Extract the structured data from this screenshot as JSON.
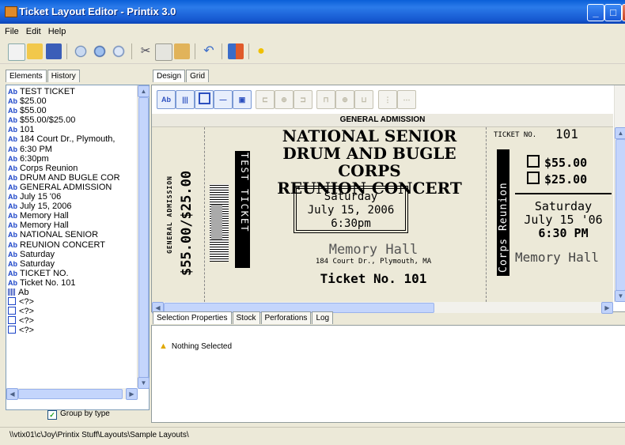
{
  "window": {
    "title": "Ticket Layout Editor - Printix 3.0",
    "min": "_",
    "max": "□",
    "close": "X"
  },
  "menu": [
    "File",
    "Edit",
    "Help"
  ],
  "left_tabs": [
    "Elements",
    "History"
  ],
  "elements": [
    {
      "kind": "text",
      "icon": "Ab",
      "label": "TEST TICKET"
    },
    {
      "kind": "text",
      "icon": "Ab",
      "label": "$25.00"
    },
    {
      "kind": "text",
      "icon": "Ab",
      "label": "$55.00"
    },
    {
      "kind": "text",
      "icon": "Ab",
      "label": "$55.00/$25.00"
    },
    {
      "kind": "text",
      "icon": "Ab",
      "label": "101"
    },
    {
      "kind": "text",
      "icon": "Ab",
      "label": "184 Court Dr., Plymouth,"
    },
    {
      "kind": "text",
      "icon": "Ab",
      "label": "6:30 PM"
    },
    {
      "kind": "text",
      "icon": "Ab",
      "label": "6:30pm"
    },
    {
      "kind": "text",
      "icon": "Ab",
      "label": "Corps Reunion"
    },
    {
      "kind": "text",
      "icon": "Ab",
      "label": "DRUM AND BUGLE COR"
    },
    {
      "kind": "text",
      "icon": "Ab",
      "label": "GENERAL ADMISSION"
    },
    {
      "kind": "text",
      "icon": "Ab",
      "label": "July 15 '06"
    },
    {
      "kind": "text",
      "icon": "Ab",
      "label": "July 15, 2006"
    },
    {
      "kind": "text",
      "icon": "Ab",
      "label": "Memory Hall"
    },
    {
      "kind": "text",
      "icon": "Ab",
      "label": "Memory Hall"
    },
    {
      "kind": "text",
      "icon": "Ab",
      "label": "NATIONAL SENIOR"
    },
    {
      "kind": "text",
      "icon": "Ab",
      "label": "REUNION CONCERT"
    },
    {
      "kind": "text",
      "icon": "Ab",
      "label": "Saturday"
    },
    {
      "kind": "text",
      "icon": "Ab",
      "label": "Saturday"
    },
    {
      "kind": "text",
      "icon": "Ab",
      "label": "TICKET NO."
    },
    {
      "kind": "text",
      "icon": "Ab",
      "label": "Ticket No. 101"
    },
    {
      "kind": "barcode",
      "icon": "",
      "label": "Ab"
    },
    {
      "kind": "box",
      "icon": "",
      "label": "<?>"
    },
    {
      "kind": "box",
      "icon": "",
      "label": "<?>"
    },
    {
      "kind": "box",
      "icon": "",
      "label": "<?>"
    },
    {
      "kind": "box",
      "icon": "",
      "label": "<?>"
    }
  ],
  "group_by_type": {
    "label": "Group by type",
    "checked": true
  },
  "design_tabs": [
    "Design",
    "Grid"
  ],
  "design_tools": [
    {
      "name": "text-tool-icon",
      "glyph": "Ab",
      "enabled": true
    },
    {
      "name": "barcode-tool-icon",
      "glyph": "|||",
      "enabled": true
    },
    {
      "name": "rectangle-tool-icon",
      "glyph": "",
      "enabled": true
    },
    {
      "name": "line-tool-icon",
      "glyph": "—",
      "enabled": true
    },
    {
      "name": "image-tool-icon",
      "glyph": "▣",
      "enabled": true
    },
    {
      "name": "align-left-icon",
      "glyph": "⊏",
      "enabled": false
    },
    {
      "name": "align-center-icon",
      "glyph": "⊕",
      "enabled": false
    },
    {
      "name": "align-right-icon",
      "glyph": "⊐",
      "enabled": false
    },
    {
      "name": "align-top-icon",
      "glyph": "⊓",
      "enabled": false
    },
    {
      "name": "align-middle-icon",
      "glyph": "⊕",
      "enabled": false
    },
    {
      "name": "align-bottom-icon",
      "glyph": "⊔",
      "enabled": false
    },
    {
      "name": "space-horizontal-icon",
      "glyph": "⋮",
      "enabled": false
    },
    {
      "name": "space-vertical-icon",
      "glyph": "⋯",
      "enabled": false
    }
  ],
  "ticket": {
    "header": "GENERAL ADMISSION",
    "line1": "NATIONAL SENIOR",
    "line2": "DRUM AND BUGLE CORPS",
    "line3": "REUNION CONCERT",
    "day": "Saturday",
    "date": "July 15, 2006",
    "time": "6:30pm",
    "venue": "Memory Hall",
    "address": "184 Court Dr., Plymouth, MA",
    "ticket_no": "Ticket No. 101",
    "side_price": "$55.00/$25.00",
    "side_label": "GENERAL ADMISSION",
    "test_ticket": "TEST TICKET",
    "stub_ticket_label": "TICKET NO.",
    "stub_ticket_num": "101",
    "stub_corps": "Corps Reunion",
    "stub_price1": "$55.00",
    "stub_price2": "$25.00",
    "stub_day": "Saturday",
    "stub_date": "July 15 '06",
    "stub_time": "6:30 PM",
    "stub_venue": "Memory Hall"
  },
  "bottom_tabs": [
    "Selection Properties",
    "Stock",
    "Perforations",
    "Log"
  ],
  "selection_message": "Nothing Selected",
  "status_path": "\\\\vtix01\\c\\Joy\\Printix Stuff\\Layouts\\Sample Layouts\\"
}
